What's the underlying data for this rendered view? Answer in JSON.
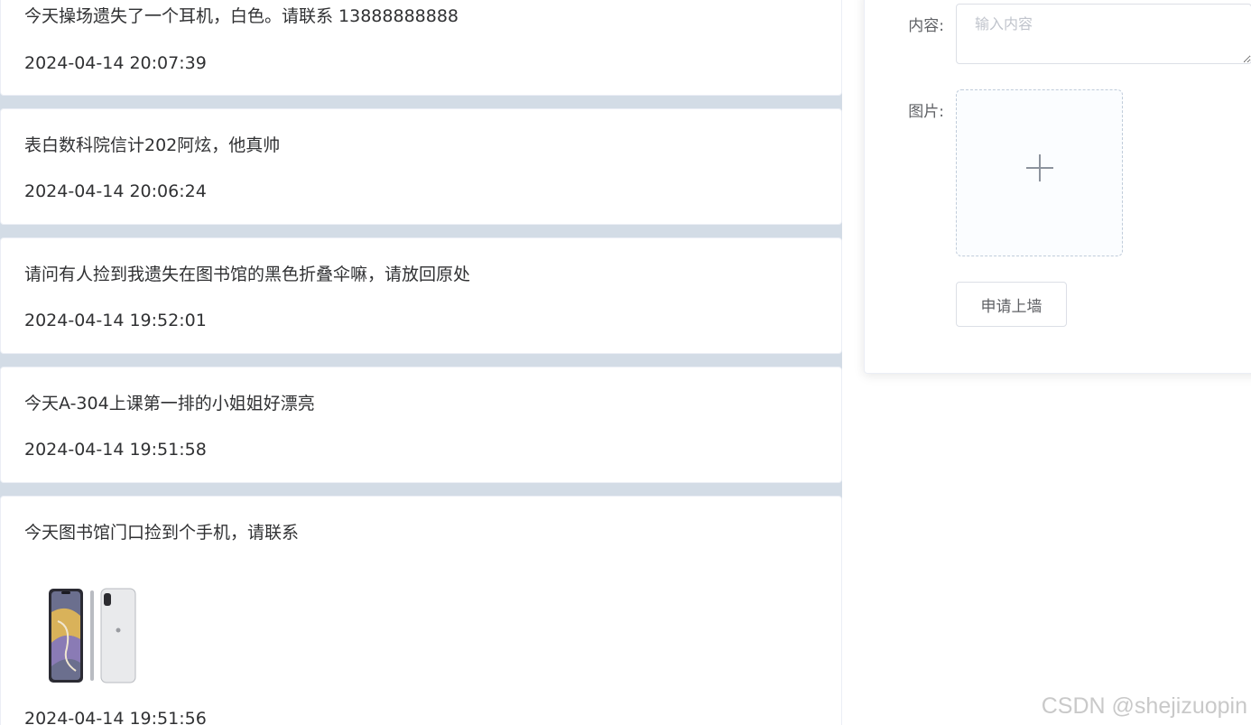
{
  "posts": [
    {
      "content": "今天操场遗失了一个耳机，白色。请联系 13888888888",
      "time": "2024-04-14 20:07:39"
    },
    {
      "content": "表白数科院信计202阿炫，他真帅",
      "time": "2024-04-14 20:06:24"
    },
    {
      "content": "请问有人捡到我遗失在图书馆的黑色折叠伞嘛，请放回原处",
      "time": "2024-04-14 19:52:01"
    },
    {
      "content": "今天A-304上课第一排的小姐姐好漂亮",
      "time": "2024-04-14 19:51:58"
    },
    {
      "content": "今天图书馆门口捡到个手机，请联系",
      "time": "2024-04-14 19:51:56"
    }
  ],
  "form": {
    "content_label": "内容:",
    "content_placeholder": "输入内容",
    "image_label": "图片:",
    "upload_icon": "plus-icon",
    "submit_label": "申请上墙"
  },
  "watermark": "CSDN @shejizuopin",
  "colors": {
    "feed_background": "#d3dce6",
    "card_background": "#ffffff",
    "placeholder": "#c0c4cc",
    "upload_border": "#c0ccda"
  }
}
